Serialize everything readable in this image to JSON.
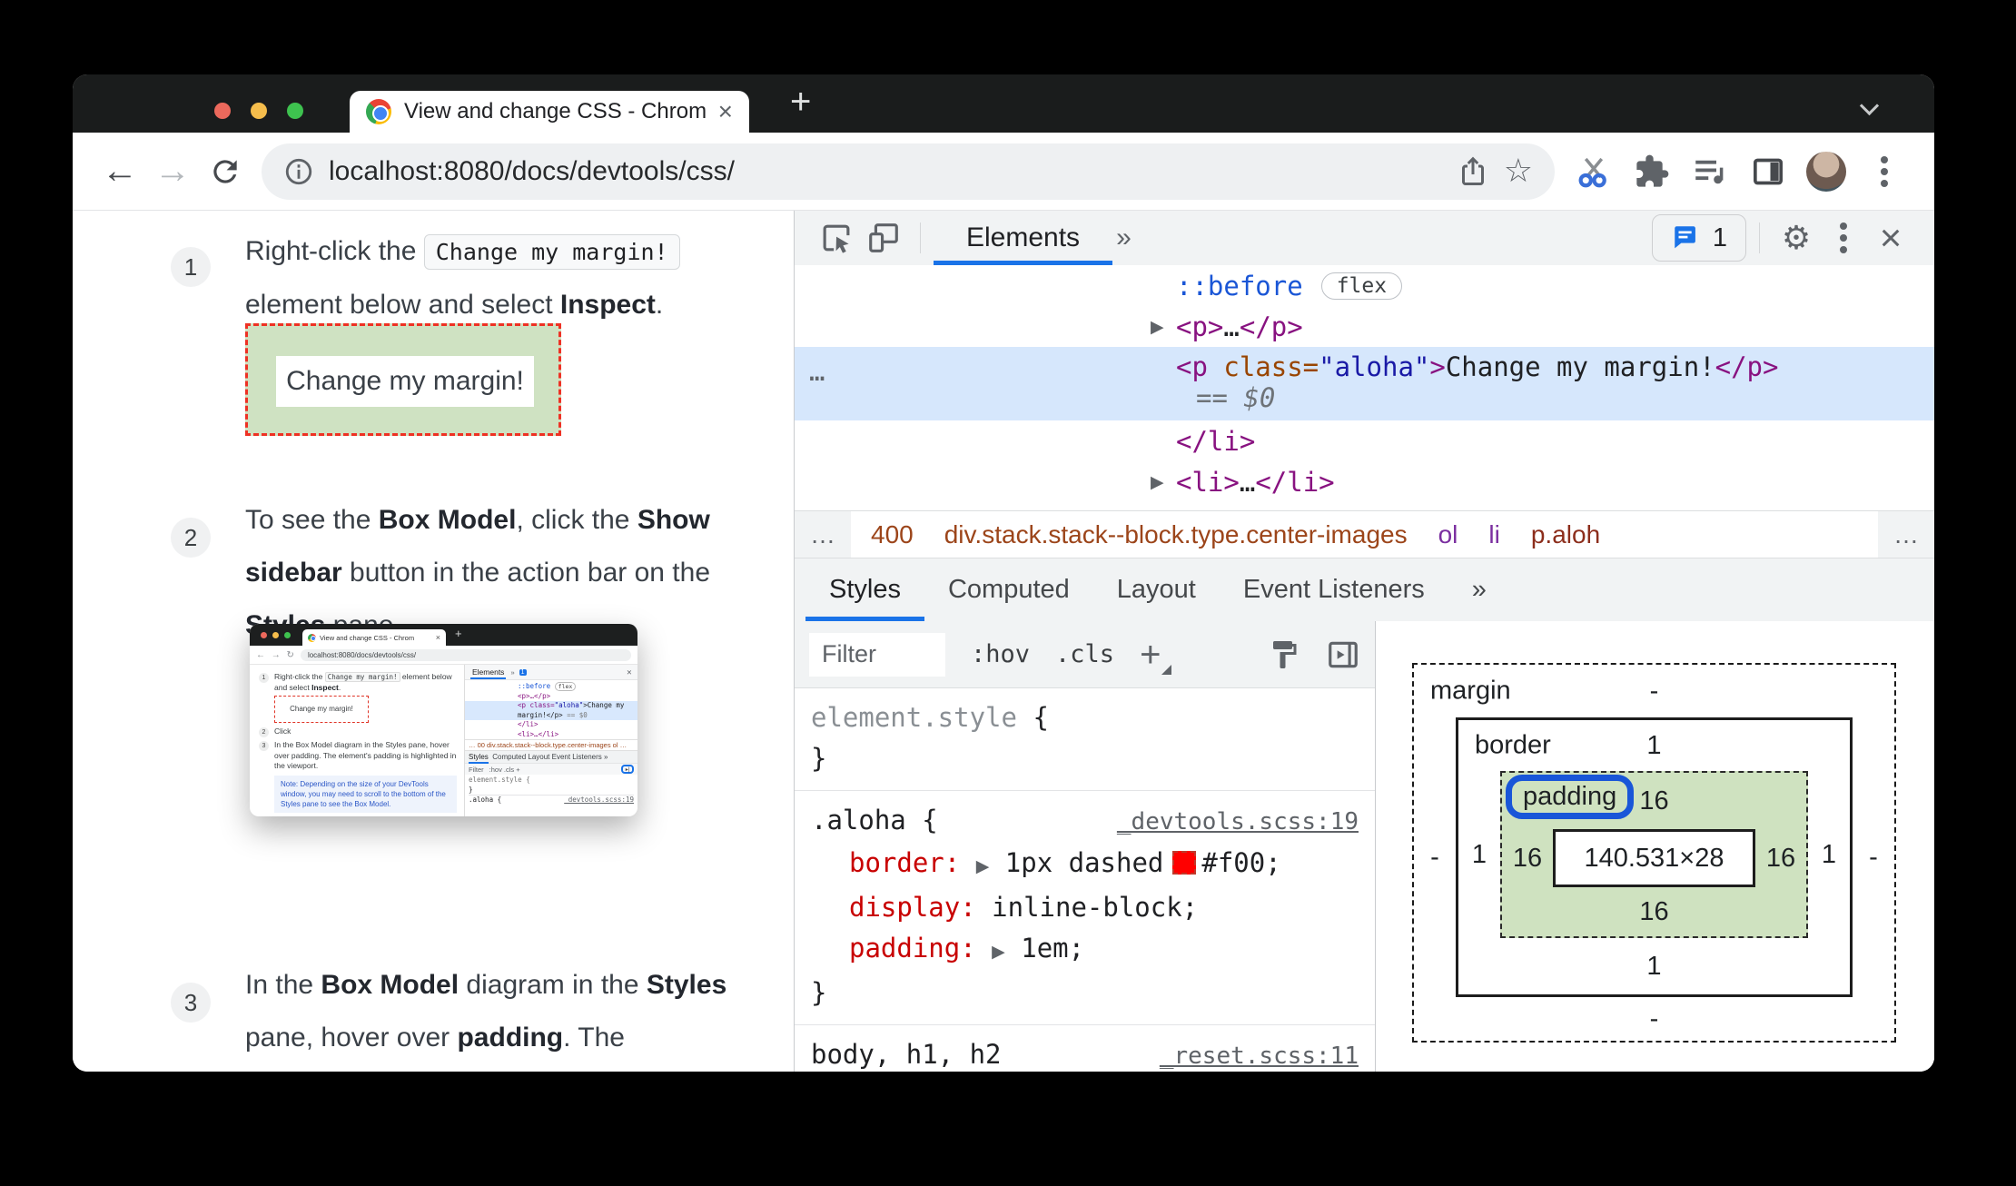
{
  "glyphs": {
    "back": "←",
    "forward": "→",
    "star": "☆",
    "gear": "⚙",
    "tab_close": "×",
    "devtools_close": "×",
    "more": "»",
    "ellipsis": "…"
  },
  "window": {
    "tab_title": "View and change CSS - Chrom",
    "new_tab": "+",
    "url": "localhost:8080/docs/devtools/css/"
  },
  "doc": {
    "step1": {
      "num": "1",
      "t1": "Right-click the ",
      "code": "Change my margin!",
      "t2": " element below and select ",
      "b1": "Inspect",
      "t3": "."
    },
    "demo": {
      "label": "Change my margin!"
    },
    "step2": {
      "num": "2",
      "t1": "To see the ",
      "b1": "Box Model",
      "t2": ", click the ",
      "b2": "Show sidebar",
      "t3": " button in the action bar on the ",
      "b3": "Styles",
      "t4": " pane."
    },
    "step3": {
      "num": "3",
      "t1": "In the ",
      "b1": "Box Model",
      "t2": " diagram in the ",
      "b2": "Styles",
      "t3": " pane, hover over ",
      "b3": "padding",
      "t4": ". The"
    },
    "thumb": {
      "tab_title": "View and change CSS - Chrom",
      "tab_close": "×",
      "new_tab": "+",
      "nav": "← → ↻",
      "url": "localhost:8080/docs/devtools/css/",
      "s1num": "1",
      "s1a": "Right-click the ",
      "s1code": "Change my margin!",
      "s1b": " element below and select ",
      "s1bold": "Inspect",
      "s1dot": ".",
      "box": "Change my margin!",
      "s2num": "2",
      "s2": "Click",
      "s3num": "3",
      "s3": "In the Box Model diagram in the Styles pane, hover over padding. The element's padding is highlighted in the viewport.",
      "note": "Note: Depending on the size of your DevTools window, you may need to scroll to the bottom of the Styles pane to see the Box Model.",
      "elements": "Elements",
      "more": "»",
      "badge": "1",
      "close": "✕",
      "tree1a": "::before",
      "tree1b": "flex",
      "tree2": "<p>…</p>",
      "tree3a": "<p class=",
      "tree3b": "\"aloha\"",
      "tree3c": ">Change my",
      "tree4a": "margin!</p>",
      "tree4b": "== $0",
      "tree5": "</li>",
      "tree6": "<li>…</li>",
      "crumbs": "… 00  div.stack.stack--block.type.center-images  ol  …",
      "tab_styles": "Styles",
      "tabs_rest": "Computed   Layout   Event Listeners   »",
      "filter": "Filter",
      "pseudo": ":hov  .cls  +",
      "rule1": "element.style {",
      "rule2": "}",
      "rule3": ".aloha {",
      "rule4": "_devtools.scss:19"
    }
  },
  "devtools": {
    "toolbar": {
      "elements": "Elements",
      "more": "»",
      "badge_count": "1"
    },
    "tree": {
      "pseudo": "::before",
      "flex_badge": "flex",
      "p_open": "<p>",
      "p_dots": "…",
      "p_close": "</p>",
      "sel_open": "<p",
      "sel_attr": " class=",
      "sel_val": "\"aloha\"",
      "sel_gt": ">",
      "sel_text": "Change my margin!",
      "sel_close": "</p>",
      "sel_eq": "== $0",
      "sel_marker": "…",
      "li_close": "</li>",
      "li_open": "<li>",
      "li_dots": "…"
    },
    "crumbs": {
      "left_more": "…",
      "c1": "400",
      "c2": "div.stack.stack--block.type.center-images",
      "c3": "ol",
      "c4": "li",
      "c5": "p.aloh",
      "right_more": "…"
    },
    "tabs": {
      "styles": "Styles",
      "computed": "Computed",
      "layout": "Layout",
      "events": "Event Listeners",
      "more": "»"
    },
    "filter": {
      "placeholder": "Filter",
      "hov": ":hov",
      "cls": ".cls",
      "plus": "+"
    },
    "rules": {
      "elem_style": {
        "selector": "element.style",
        "open": "{",
        "close": "}"
      },
      "aloha": {
        "selector": ".aloha {",
        "link": "_devtools.scss:19",
        "p1n": "border:",
        "p1v": "1px dashed",
        "p1c": "#f00;",
        "p2n": "display:",
        "p2v": "inline-block;",
        "p3n": "padding:",
        "p3v": "1em;",
        "close": "}"
      },
      "clipped": {
        "selector": "body, h1, h2",
        "link": "_reset.scss:11"
      }
    },
    "box_model": {
      "margin_label": "margin",
      "border_label": "border",
      "padding_label": "padding",
      "content": "140.531×28",
      "margin": {
        "t": "-",
        "l": "-",
        "r": "-",
        "b": "-"
      },
      "border": {
        "t": "1",
        "l": "1",
        "r": "1",
        "b": "1"
      },
      "padding": {
        "t": "16",
        "l": "16",
        "r": "16",
        "b": "16"
      }
    }
  }
}
